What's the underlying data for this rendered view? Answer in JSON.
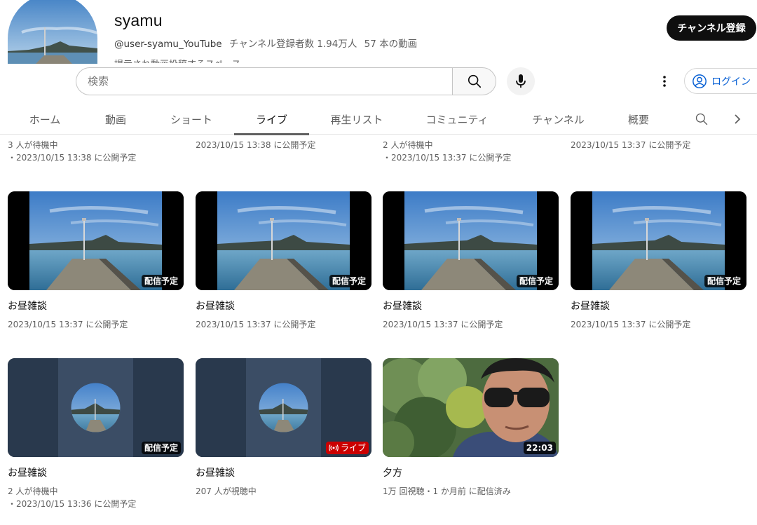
{
  "channel": {
    "name": "syamu",
    "handle": "@user-syamu_YouTube",
    "subscribers": "チャンネル登録者数 1.94万人",
    "video_count": "57 本の動画",
    "description": "提示され動画投稿するスペース",
    "subscribe_label": "チャンネル登録"
  },
  "search": {
    "placeholder": "検索"
  },
  "login_label": "ログイン",
  "tabs": [
    {
      "label": "ホーム"
    },
    {
      "label": "動画"
    },
    {
      "label": "ショート"
    },
    {
      "label": "ライブ",
      "active": true
    },
    {
      "label": "再生リスト"
    },
    {
      "label": "コミュニティ"
    },
    {
      "label": "チャンネル"
    },
    {
      "label": "概要"
    }
  ],
  "prev_row": [
    {
      "line1": "3 人が待機中",
      "line2": "・2023/10/15 13:38 に公開予定"
    },
    {
      "line1": "2023/10/15 13:38 に公開予定",
      "line2": ""
    },
    {
      "line1": "2 人が待機中",
      "line2": "・2023/10/15 13:37 に公開予定"
    },
    {
      "line1": "2023/10/15 13:37 に公開予定",
      "line2": ""
    }
  ],
  "videos": [
    {
      "title": "お昼雑談",
      "meta1": "2023/10/15 13:37 に公開予定",
      "meta2": "",
      "badge": "配信予定"
    },
    {
      "title": "お昼雑談",
      "meta1": "2023/10/15 13:37 に公開予定",
      "meta2": "",
      "badge": "配信予定"
    },
    {
      "title": "お昼雑談",
      "meta1": "2023/10/15 13:37 に公開予定",
      "meta2": "",
      "badge": "配信予定"
    },
    {
      "title": "お昼雑談",
      "meta1": "2023/10/15 13:37 に公開予定",
      "meta2": "",
      "badge": "配信予定"
    },
    {
      "title": "お昼雑談",
      "meta1": "2 人が待機中",
      "meta2": "・2023/10/15 13:36 に公開予定",
      "badge": "配信予定"
    },
    {
      "title": "お昼雑談",
      "meta1": "207 人が視聴中",
      "meta2": "",
      "badge": "ライブ"
    },
    {
      "title": "夕方",
      "meta1": "1万 回視聴・1 か月前 に配信済み",
      "meta2": "",
      "badge": "22:03"
    }
  ]
}
